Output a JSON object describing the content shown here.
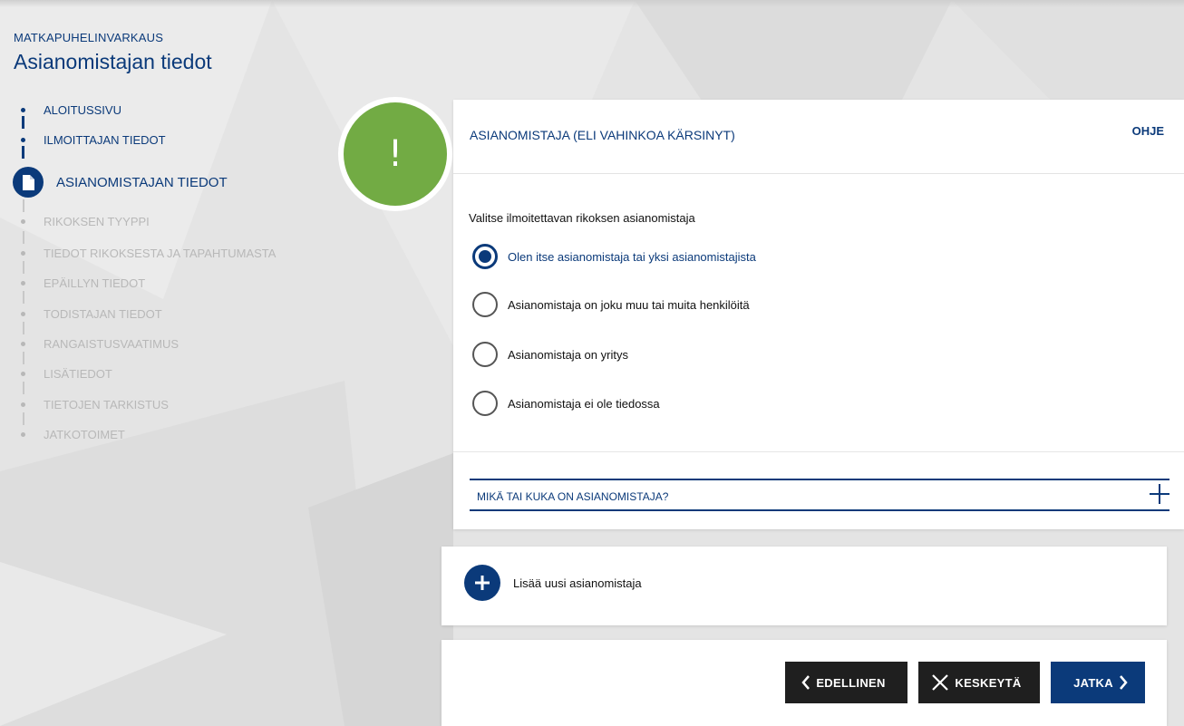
{
  "header": {
    "subtitle": "MATKAPUHELINVARKAUS",
    "title": "Asianomistajan tiedot"
  },
  "steps": [
    {
      "label": "ALOITUSSIVU",
      "state": "done"
    },
    {
      "label": "ILMOITTAJAN TIEDOT",
      "state": "done"
    },
    {
      "label": "ASIANOMISTAJAN TIEDOT",
      "state": "current",
      "icon": "document-icon"
    },
    {
      "label": "RIKOKSEN TYYPPI",
      "state": "future"
    },
    {
      "label": "TIEDOT RIKOKSESTA JA TAPAHTUMASTA",
      "state": "future"
    },
    {
      "label": "EPÄILLYN TIEDOT",
      "state": "future"
    },
    {
      "label": "TODISTAJAN TIEDOT",
      "state": "future"
    },
    {
      "label": "RANGAISTUSVAATIMUS",
      "state": "future"
    },
    {
      "label": "LISÄTIEDOT",
      "state": "future"
    },
    {
      "label": "TIETOJEN TARKISTUS",
      "state": "future"
    },
    {
      "label": "JATKOTOIMET",
      "state": "future"
    }
  ],
  "alert": {
    "symbol": "!",
    "color": "#72ab44"
  },
  "section": {
    "title": "ASIANOMISTAJA (ELI VAHINKOA KÄRSINYT)",
    "help": "OHJE",
    "question": "Valitse ilmoitettavan rikoksen asianomistaja",
    "options": [
      {
        "label": "Olen itse asianomistaja tai yksi asianomistajista",
        "selected": true
      },
      {
        "label": "Asianomistaja on joku muu tai muita henkilöitä",
        "selected": false
      },
      {
        "label": "Asianomistaja on yritys",
        "selected": false
      },
      {
        "label": "Asianomistaja ei ole tiedossa",
        "selected": false
      }
    ],
    "accordion": {
      "label": "MIKÄ TAI KUKA ON ASIANOMISTAJA?",
      "icon": "plus-icon"
    }
  },
  "add_party": {
    "label": "Lisää uusi asianomistaja",
    "icon": "plus-circle-icon"
  },
  "footer": {
    "previous": "EDELLINEN",
    "cancel": "KESKEYTÄ",
    "next": "JATKA"
  },
  "colors": {
    "primary": "#0b3a7a",
    "dark": "#1f1f1f",
    "success": "#72ab44",
    "muted": "#b8b8b8"
  }
}
